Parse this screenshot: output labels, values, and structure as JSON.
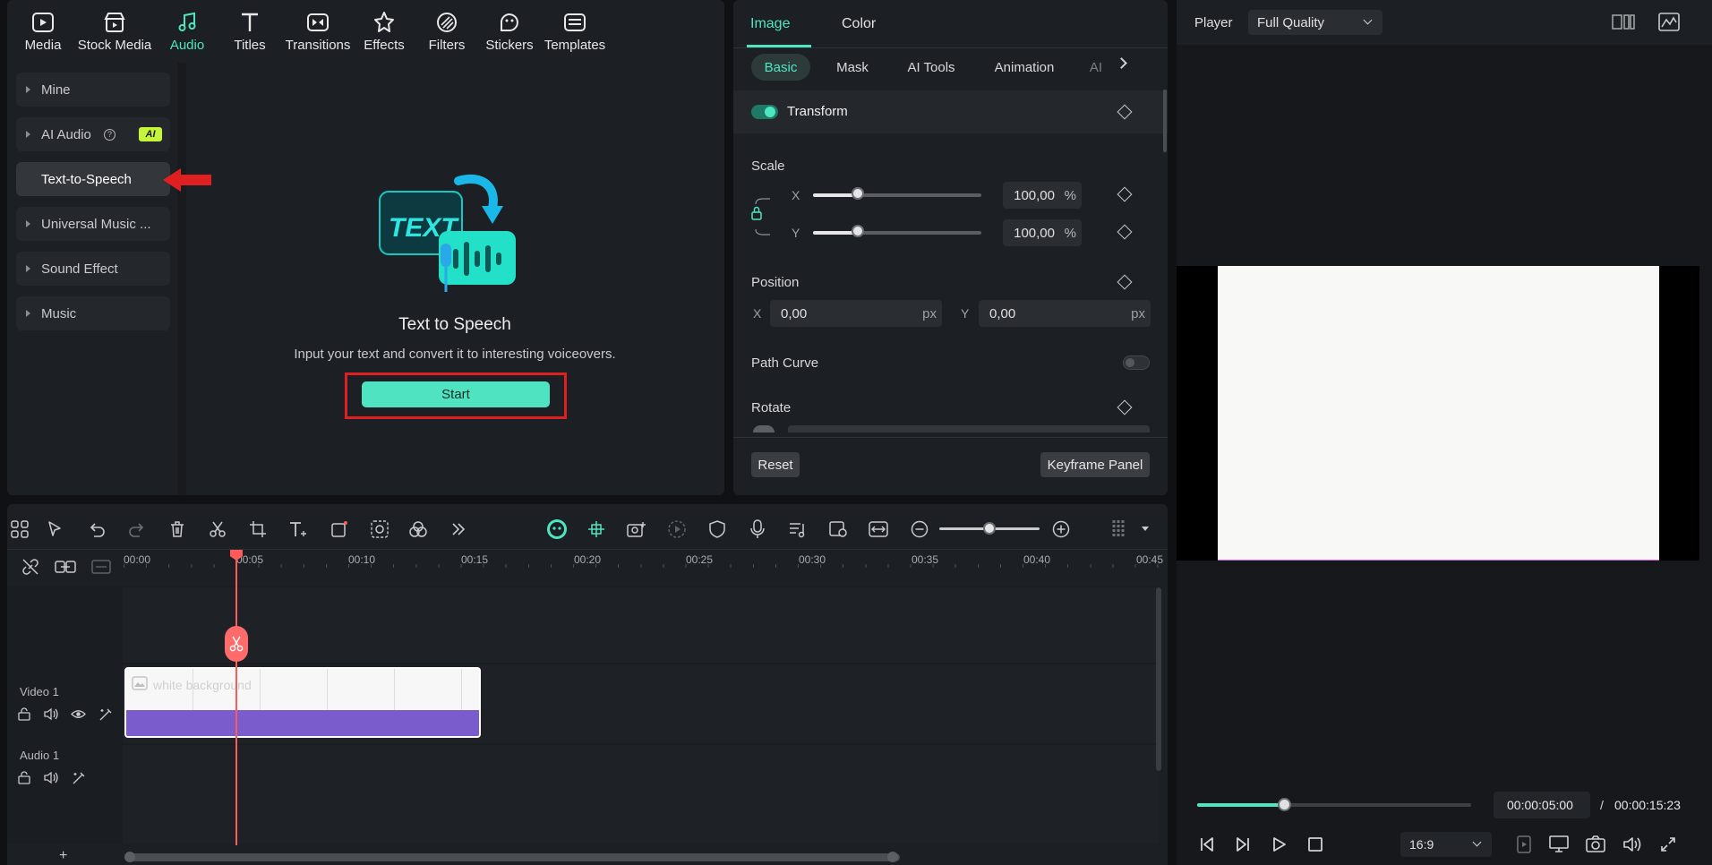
{
  "media_tabs": [
    {
      "label": "Media",
      "icon": "media-icon"
    },
    {
      "label": "Stock Media",
      "icon": "stock-media-icon"
    },
    {
      "label": "Audio",
      "icon": "audio-note-icon",
      "active": true
    },
    {
      "label": "Titles",
      "icon": "titles-icon"
    },
    {
      "label": "Transitions",
      "icon": "transitions-icon"
    },
    {
      "label": "Effects",
      "icon": "effects-icon"
    },
    {
      "label": "Filters",
      "icon": "filters-icon"
    },
    {
      "label": "Stickers",
      "icon": "stickers-icon"
    },
    {
      "label": "Templates",
      "icon": "templates-icon"
    }
  ],
  "sidebar": {
    "items": [
      {
        "label": "Mine"
      },
      {
        "label": "AI Audio",
        "badge": "AI"
      },
      {
        "label": "Text-to-Speech",
        "selected": true
      },
      {
        "label": "Universal Music ..."
      },
      {
        "label": "Sound Effect"
      },
      {
        "label": "Music"
      }
    ]
  },
  "tts": {
    "graphic_text": "TEXT",
    "title": "Text to Speech",
    "description": "Input your text and convert it to interesting voiceovers.",
    "start_label": "Start"
  },
  "inspector": {
    "tabs": [
      "Image",
      "Color"
    ],
    "subtabs": [
      "Basic",
      "Mask",
      "AI Tools",
      "Animation",
      "AI"
    ],
    "transform_label": "Transform",
    "scale_label": "Scale",
    "scale_x_axis": "X",
    "scale_y_axis": "Y",
    "scale_x": "100,00",
    "scale_y": "100,00",
    "scale_x_fraction": 0.27,
    "scale_y_fraction": 0.27,
    "percent": "%",
    "position_label": "Position",
    "pos_x_axis": "X",
    "pos_y_axis": "Y",
    "pos_x": "0,00",
    "pos_y": "0,00",
    "px": "px",
    "path_curve_label": "Path Curve",
    "rotate_label": "Rotate",
    "reset_label": "Reset",
    "keyframe_label": "Keyframe Panel"
  },
  "player": {
    "label": "Player",
    "quality": "Full Quality",
    "current_time": "00:00:05:00",
    "separator": "/",
    "total_time": "00:00:15:23",
    "progress_fraction": 0.32,
    "ratio": "16:9"
  },
  "timeline": {
    "ticks": [
      "00:00",
      "00:05",
      "00:10",
      "00:15",
      "00:20",
      "00:25",
      "00:30",
      "00:35",
      "00:40",
      "00:45"
    ],
    "video_track": "Video 1",
    "audio_track": "Audio 1",
    "clip_name": "white background",
    "add_symbol": "+"
  },
  "colors": {
    "accent": "#4ee6c1",
    "highlight_red": "#e02020",
    "playhead": "#ff5a5a",
    "clip_purple": "#7a5ccc"
  }
}
